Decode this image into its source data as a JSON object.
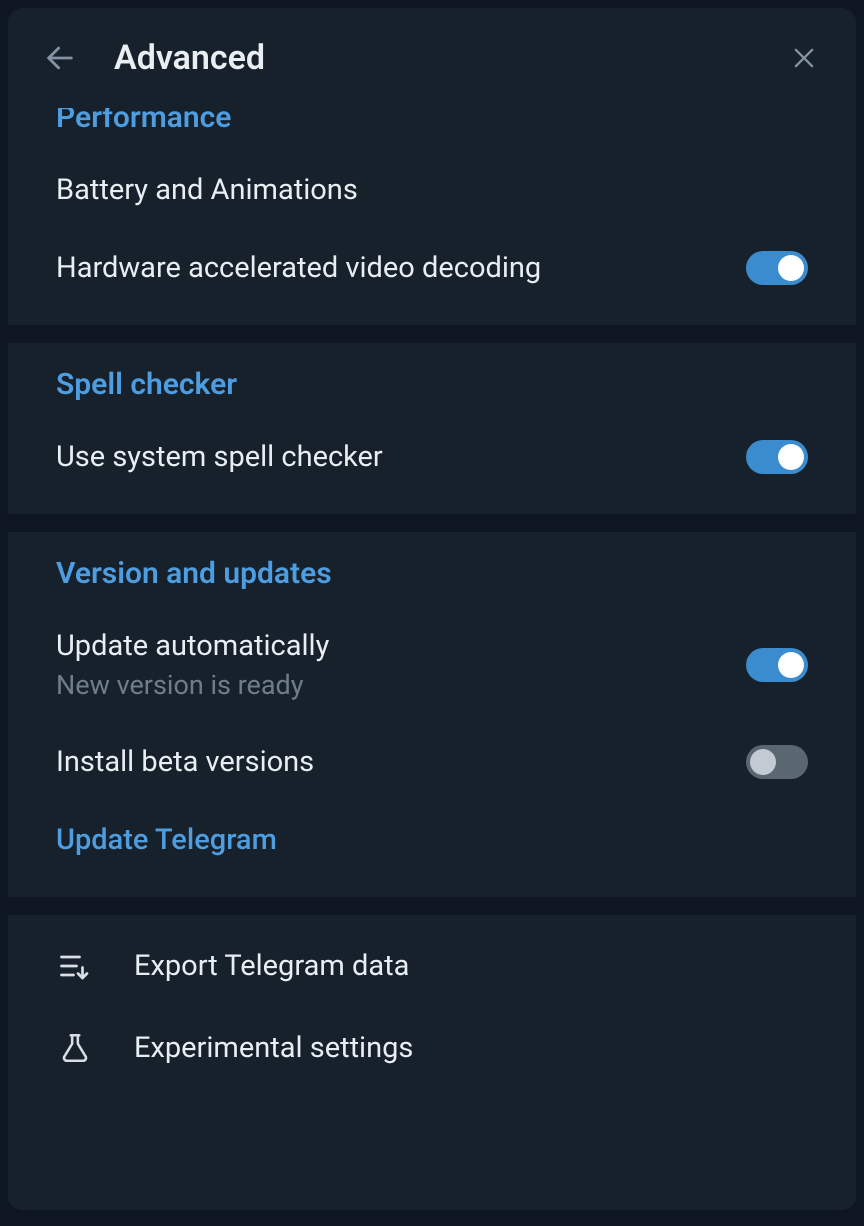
{
  "header": {
    "title": "Advanced"
  },
  "sections": {
    "performance": {
      "title": "Performance",
      "battery": "Battery and Animations",
      "hwdecode": "Hardware accelerated video decoding"
    },
    "spell": {
      "title": "Spell checker",
      "use_system": "Use system spell checker"
    },
    "version": {
      "title": "Version and updates",
      "auto_update": "Update automatically",
      "auto_update_sub": "New version is ready",
      "install_beta": "Install beta versions",
      "update_link": "Update Telegram"
    },
    "actions": {
      "export": "Export Telegram data",
      "experimental": "Experimental settings"
    }
  },
  "toggles": {
    "hwdecode": true,
    "use_system": true,
    "auto_update": true,
    "install_beta": false
  }
}
